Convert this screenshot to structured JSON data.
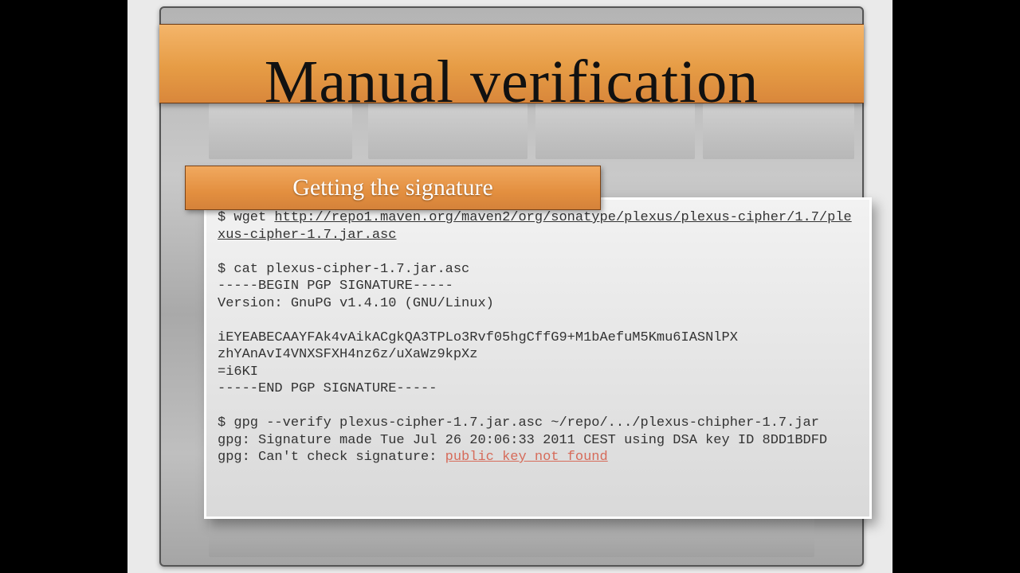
{
  "slide": {
    "title": "Manual verification",
    "subtitle": "Getting the signature"
  },
  "terminal": {
    "cmd1_prefix": "$ wget ",
    "cmd1_url": "http://repo1.maven.org/maven2/org/sonatype/plexus/plexus-cipher/1.7/plexus-cipher-1.7.jar.asc",
    "blank1": "",
    "cmd2": "$ cat plexus-cipher-1.7.jar.asc",
    "sig_begin": "-----BEGIN PGP SIGNATURE-----",
    "sig_ver": "Version: GnuPG v1.4.10 (GNU/Linux)",
    "blank2": "",
    "sig_l1": "iEYEABECAAYFAk4vAikACgkQA3TPLo3Rvf05hgCffG9+M1bAefuM5Kmu6IASNlPX",
    "sig_l2": "zhYAnAvI4VNXSFXH4nz6z/uXaWz9kpXz",
    "sig_l3": "=i6KI",
    "sig_end": "-----END PGP SIGNATURE-----",
    "blank3": "",
    "cmd3": "$ gpg --verify plexus-cipher-1.7.jar.asc ~/repo/.../plexus-chipher-1.7.jar",
    "out1": "gpg: Signature made Tue Jul 26 20:06:33 2011 CEST using DSA key ID 8DD1BDFD",
    "out2_prefix": "gpg: Can't check signature: ",
    "out2_err": "public key not found"
  }
}
